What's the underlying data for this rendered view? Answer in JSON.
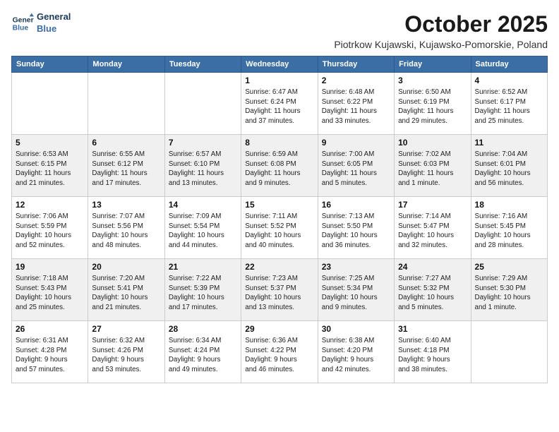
{
  "logo": {
    "line1": "General",
    "line2": "Blue"
  },
  "title": "October 2025",
  "subtitle": "Piotrkow Kujawski, Kujawsko-Pomorskie, Poland",
  "headers": [
    "Sunday",
    "Monday",
    "Tuesday",
    "Wednesday",
    "Thursday",
    "Friday",
    "Saturday"
  ],
  "weeks": [
    [
      {
        "day": "",
        "detail": ""
      },
      {
        "day": "",
        "detail": ""
      },
      {
        "day": "",
        "detail": ""
      },
      {
        "day": "1",
        "detail": "Sunrise: 6:47 AM\nSunset: 6:24 PM\nDaylight: 11 hours\nand 37 minutes."
      },
      {
        "day": "2",
        "detail": "Sunrise: 6:48 AM\nSunset: 6:22 PM\nDaylight: 11 hours\nand 33 minutes."
      },
      {
        "day": "3",
        "detail": "Sunrise: 6:50 AM\nSunset: 6:19 PM\nDaylight: 11 hours\nand 29 minutes."
      },
      {
        "day": "4",
        "detail": "Sunrise: 6:52 AM\nSunset: 6:17 PM\nDaylight: 11 hours\nand 25 minutes."
      }
    ],
    [
      {
        "day": "5",
        "detail": "Sunrise: 6:53 AM\nSunset: 6:15 PM\nDaylight: 11 hours\nand 21 minutes."
      },
      {
        "day": "6",
        "detail": "Sunrise: 6:55 AM\nSunset: 6:12 PM\nDaylight: 11 hours\nand 17 minutes."
      },
      {
        "day": "7",
        "detail": "Sunrise: 6:57 AM\nSunset: 6:10 PM\nDaylight: 11 hours\nand 13 minutes."
      },
      {
        "day": "8",
        "detail": "Sunrise: 6:59 AM\nSunset: 6:08 PM\nDaylight: 11 hours\nand 9 minutes."
      },
      {
        "day": "9",
        "detail": "Sunrise: 7:00 AM\nSunset: 6:05 PM\nDaylight: 11 hours\nand 5 minutes."
      },
      {
        "day": "10",
        "detail": "Sunrise: 7:02 AM\nSunset: 6:03 PM\nDaylight: 11 hours\nand 1 minute."
      },
      {
        "day": "11",
        "detail": "Sunrise: 7:04 AM\nSunset: 6:01 PM\nDaylight: 10 hours\nand 56 minutes."
      }
    ],
    [
      {
        "day": "12",
        "detail": "Sunrise: 7:06 AM\nSunset: 5:59 PM\nDaylight: 10 hours\nand 52 minutes."
      },
      {
        "day": "13",
        "detail": "Sunrise: 7:07 AM\nSunset: 5:56 PM\nDaylight: 10 hours\nand 48 minutes."
      },
      {
        "day": "14",
        "detail": "Sunrise: 7:09 AM\nSunset: 5:54 PM\nDaylight: 10 hours\nand 44 minutes."
      },
      {
        "day": "15",
        "detail": "Sunrise: 7:11 AM\nSunset: 5:52 PM\nDaylight: 10 hours\nand 40 minutes."
      },
      {
        "day": "16",
        "detail": "Sunrise: 7:13 AM\nSunset: 5:50 PM\nDaylight: 10 hours\nand 36 minutes."
      },
      {
        "day": "17",
        "detail": "Sunrise: 7:14 AM\nSunset: 5:47 PM\nDaylight: 10 hours\nand 32 minutes."
      },
      {
        "day": "18",
        "detail": "Sunrise: 7:16 AM\nSunset: 5:45 PM\nDaylight: 10 hours\nand 28 minutes."
      }
    ],
    [
      {
        "day": "19",
        "detail": "Sunrise: 7:18 AM\nSunset: 5:43 PM\nDaylight: 10 hours\nand 25 minutes."
      },
      {
        "day": "20",
        "detail": "Sunrise: 7:20 AM\nSunset: 5:41 PM\nDaylight: 10 hours\nand 21 minutes."
      },
      {
        "day": "21",
        "detail": "Sunrise: 7:22 AM\nSunset: 5:39 PM\nDaylight: 10 hours\nand 17 minutes."
      },
      {
        "day": "22",
        "detail": "Sunrise: 7:23 AM\nSunset: 5:37 PM\nDaylight: 10 hours\nand 13 minutes."
      },
      {
        "day": "23",
        "detail": "Sunrise: 7:25 AM\nSunset: 5:34 PM\nDaylight: 10 hours\nand 9 minutes."
      },
      {
        "day": "24",
        "detail": "Sunrise: 7:27 AM\nSunset: 5:32 PM\nDaylight: 10 hours\nand 5 minutes."
      },
      {
        "day": "25",
        "detail": "Sunrise: 7:29 AM\nSunset: 5:30 PM\nDaylight: 10 hours\nand 1 minute."
      }
    ],
    [
      {
        "day": "26",
        "detail": "Sunrise: 6:31 AM\nSunset: 4:28 PM\nDaylight: 9 hours\nand 57 minutes."
      },
      {
        "day": "27",
        "detail": "Sunrise: 6:32 AM\nSunset: 4:26 PM\nDaylight: 9 hours\nand 53 minutes."
      },
      {
        "day": "28",
        "detail": "Sunrise: 6:34 AM\nSunset: 4:24 PM\nDaylight: 9 hours\nand 49 minutes."
      },
      {
        "day": "29",
        "detail": "Sunrise: 6:36 AM\nSunset: 4:22 PM\nDaylight: 9 hours\nand 46 minutes."
      },
      {
        "day": "30",
        "detail": "Sunrise: 6:38 AM\nSunset: 4:20 PM\nDaylight: 9 hours\nand 42 minutes."
      },
      {
        "day": "31",
        "detail": "Sunrise: 6:40 AM\nSunset: 4:18 PM\nDaylight: 9 hours\nand 38 minutes."
      },
      {
        "day": "",
        "detail": ""
      }
    ]
  ]
}
